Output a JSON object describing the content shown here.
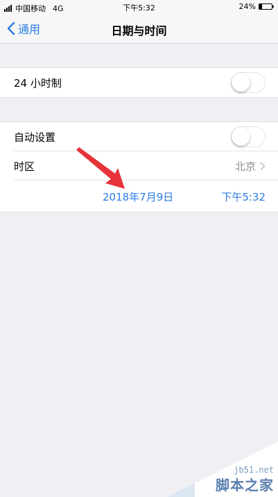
{
  "status_bar": {
    "carrier": "中国移动",
    "network": "4G",
    "time": "下午5:32",
    "battery_percent": "24%",
    "battery_level": 0.24
  },
  "nav": {
    "back_label": "通用",
    "title": "日期与时间"
  },
  "settings": {
    "hour24": {
      "label": "24 小时制",
      "enabled": false
    },
    "auto_set": {
      "label": "自动设置",
      "enabled": false
    },
    "timezone": {
      "label": "时区",
      "value": "北京"
    },
    "date": "2018年7月9日",
    "time": "下午5:32"
  },
  "watermark": {
    "site": "jb51.net",
    "name": "脚本之家"
  },
  "colors": {
    "accent": "#2a7ce6",
    "annotation": "#e8323a"
  }
}
